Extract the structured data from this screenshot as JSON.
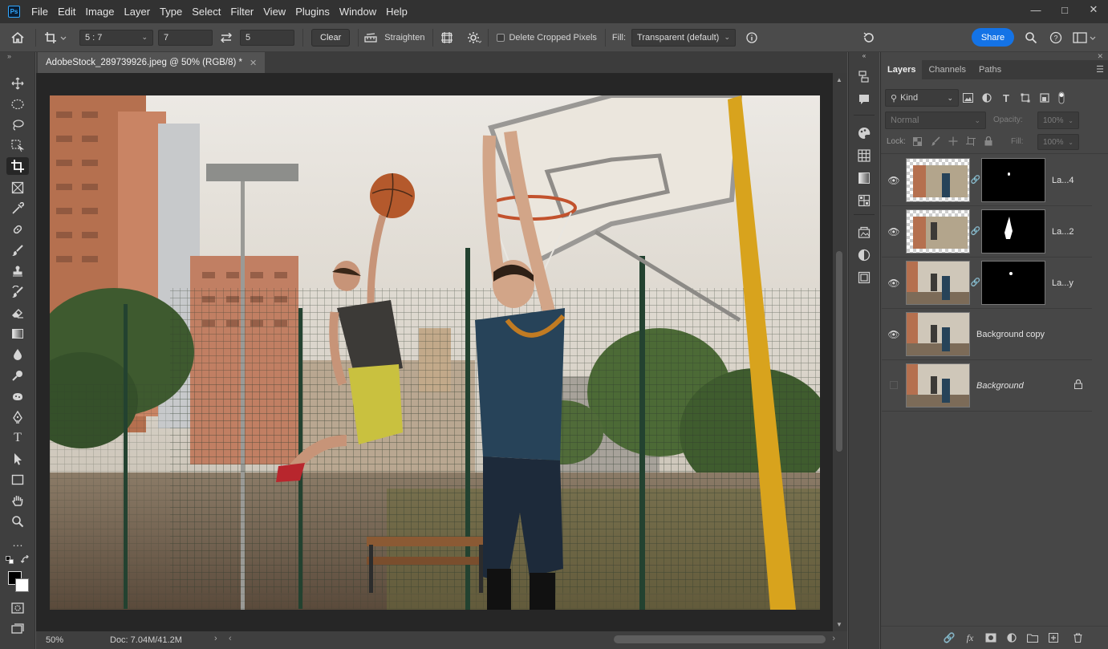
{
  "menubar": {
    "logo": "Ps",
    "items": [
      "File",
      "Edit",
      "Image",
      "Layer",
      "Type",
      "Select",
      "Filter",
      "View",
      "Plugins",
      "Window",
      "Help"
    ]
  },
  "options": {
    "ratio": "5 : 7",
    "width": "7",
    "height": "5",
    "clear": "Clear",
    "straighten": "Straighten",
    "delete_cropped": "Delete Cropped Pixels",
    "fill_label": "Fill:",
    "fill_value": "Transparent (default)",
    "share": "Share"
  },
  "document": {
    "tab_title": "AdobeStock_289739926.jpeg @ 50% (RGB/8) *",
    "zoom": "50%",
    "doc_info": "Doc: 7.04M/41.2M"
  },
  "layers_panel": {
    "tabs": [
      "Layers",
      "Channels",
      "Paths"
    ],
    "filter": "Kind",
    "blend_mode": "Normal",
    "opacity_label": "Opacity:",
    "opacity_value": "100%",
    "lock_label": "Lock:",
    "fill_label": "Fill:",
    "fill_value": "100%",
    "layers": [
      {
        "name": "La...4",
        "visible": true,
        "has_mask": true
      },
      {
        "name": "La...2",
        "visible": true,
        "has_mask": true
      },
      {
        "name": "La...y",
        "visible": true,
        "has_mask": true
      },
      {
        "name": "Background copy",
        "visible": true,
        "has_mask": false
      },
      {
        "name": "Background",
        "visible": false,
        "has_mask": false,
        "locked": true
      }
    ]
  },
  "colors": {
    "accent": "#1473e6",
    "foreground": "#000000",
    "background": "#ffffff"
  }
}
